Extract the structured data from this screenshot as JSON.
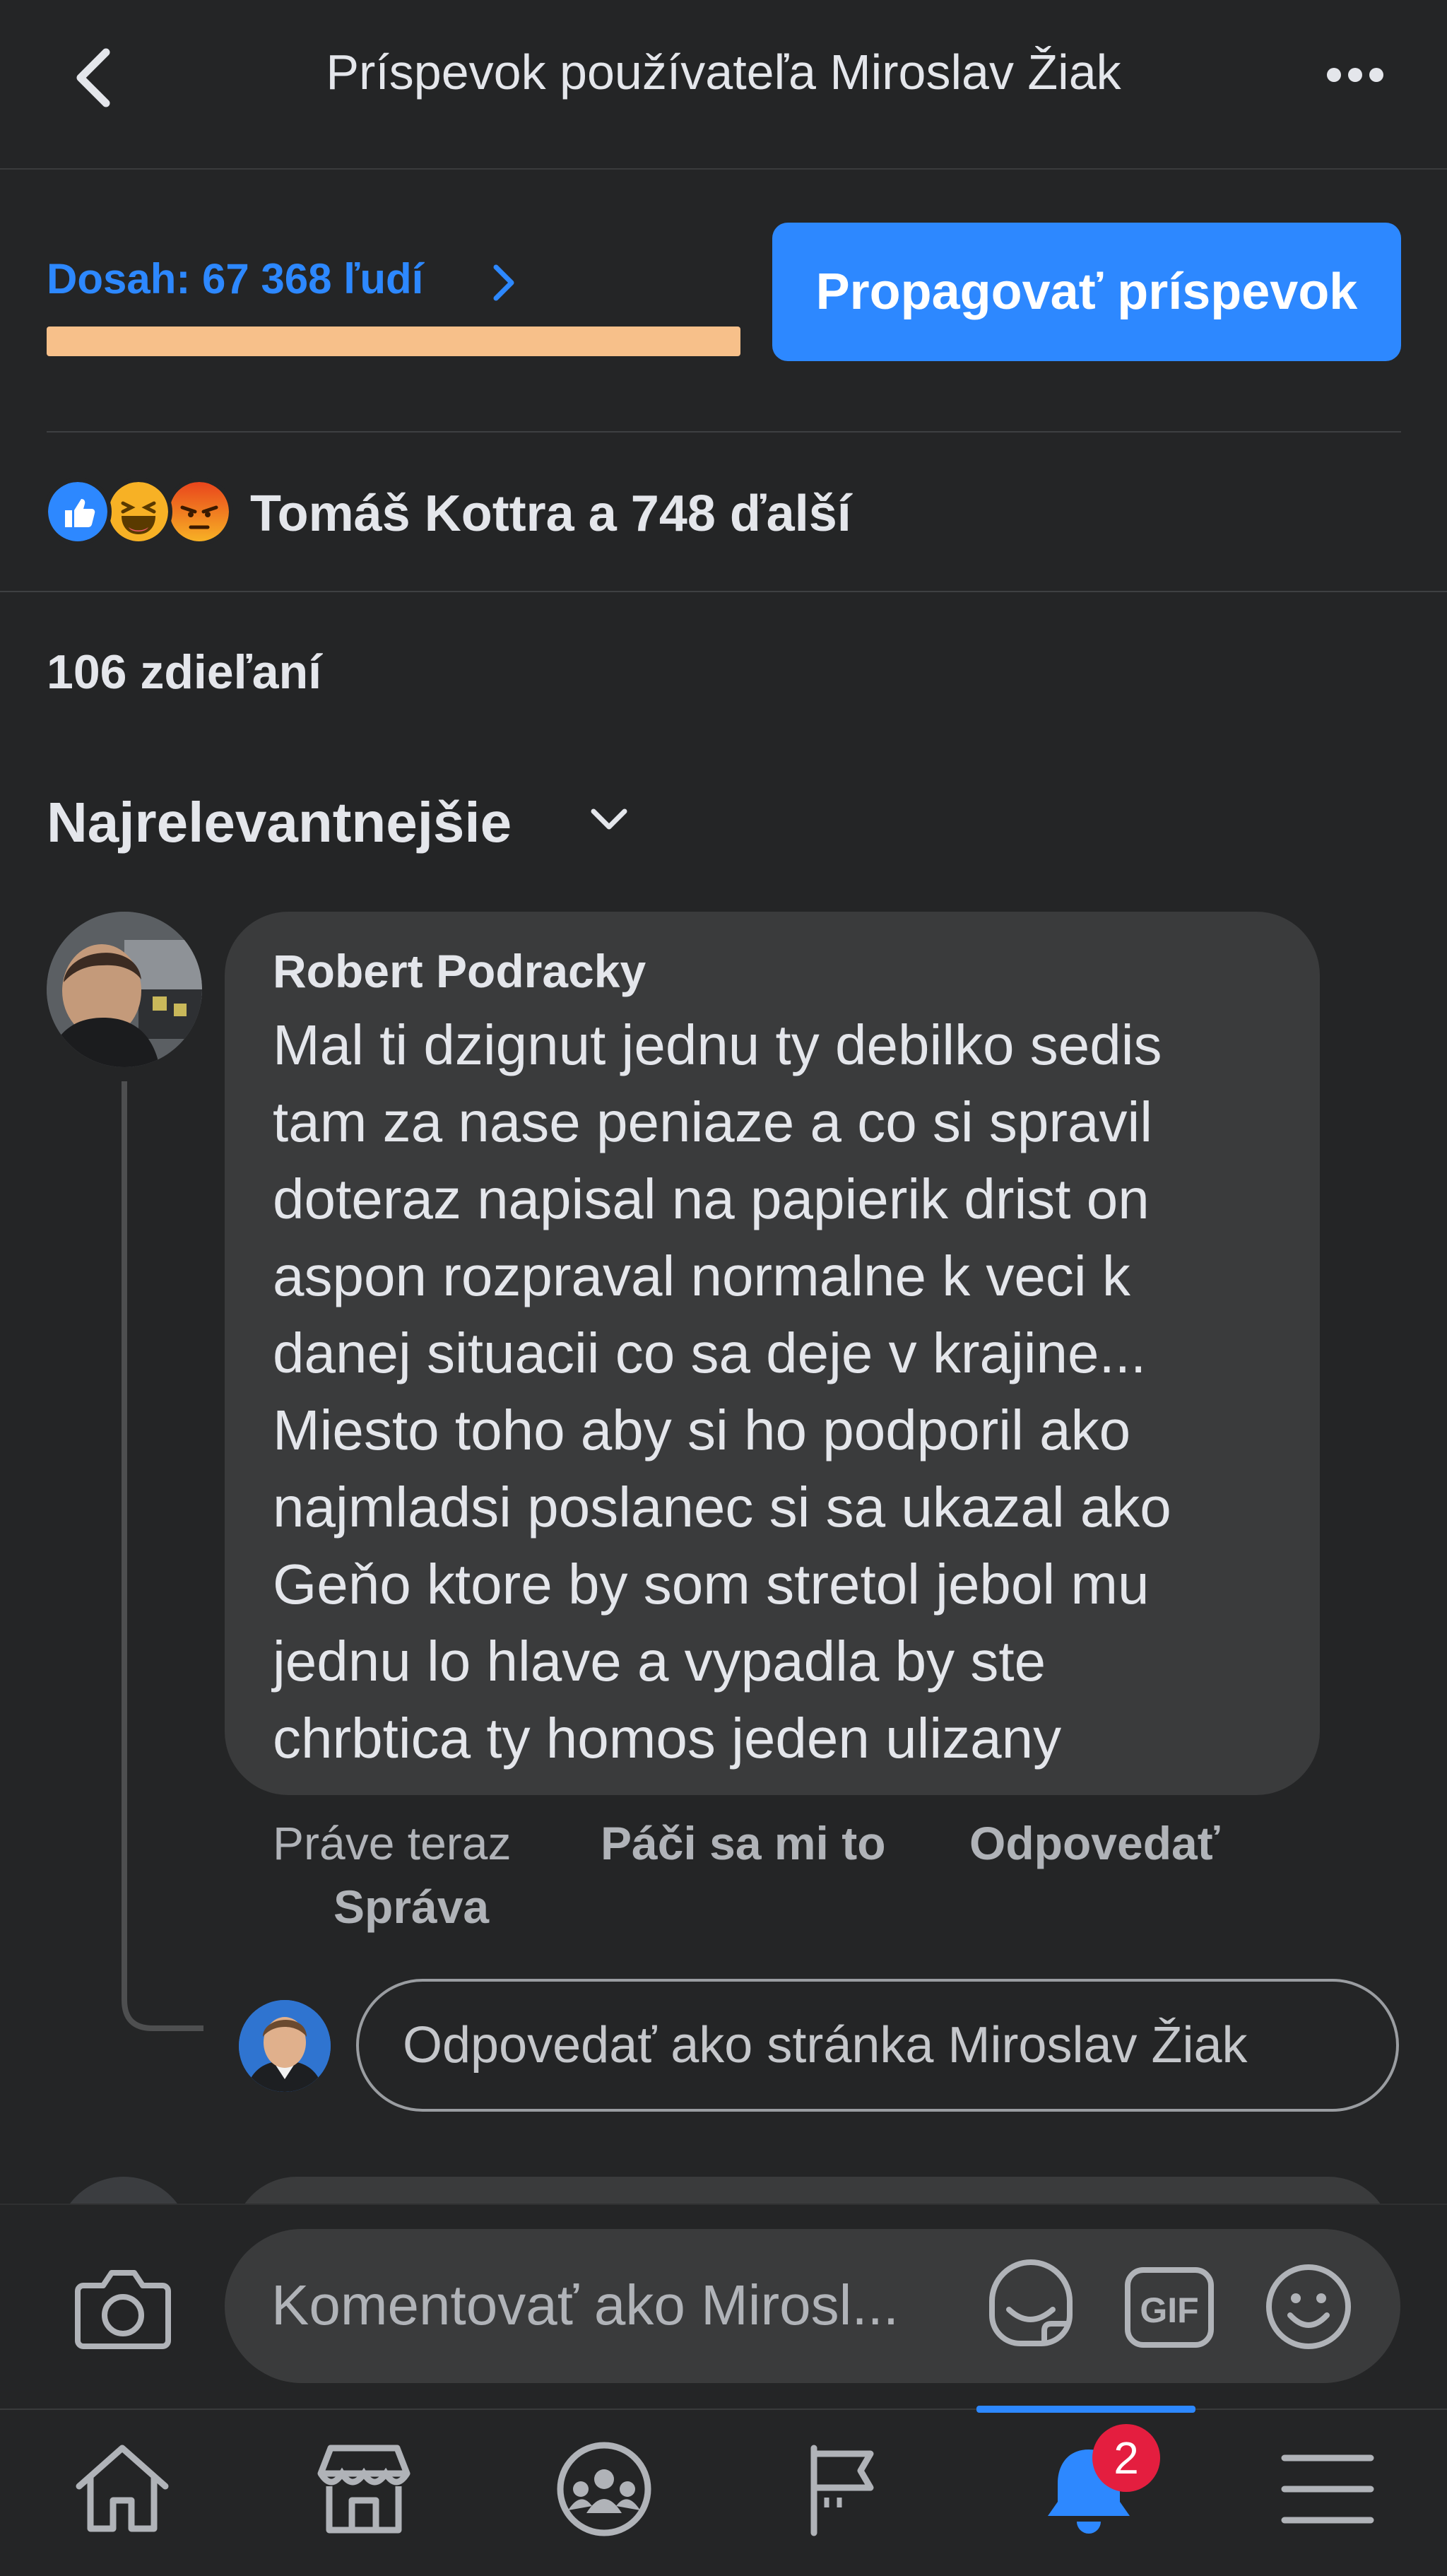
{
  "header": {
    "title": "Príspevok používateľa Miroslav Žiak"
  },
  "reach": {
    "label": "Dosah: 67 368 ľudí",
    "bar_fill": 1.0,
    "bar_color": "#f7c08a"
  },
  "promote_button": "Propagovať príspevok",
  "reactions": {
    "icons": [
      "like-icon",
      "haha-icon",
      "angry-icon"
    ],
    "summary": "Tomáš Kottra a 748 ďalší"
  },
  "shares": "106 zdieľaní",
  "sort": "Najrelevantnejšie",
  "comment": {
    "author": "Robert Podracky",
    "text": "Mal ti dzignut jednu ty debilko sedis\ntam za nase peniaze a co si  spravil\ndoteraz napisal na papierik drist on\naspon rozpraval normalne k veci k\ndanej situacii co sa deje v krajine...\nMiesto toho aby si ho podporil ako\nnajmladsi poslanec si sa ukazal ako\nGeňo ktore by som stretol jebol mu\njednu lo hlave a vypadla by ste\nchrbtica ty homos jeden ulizany",
    "time": "Práve teraz",
    "like": "Páči sa mi to",
    "reply": "Odpovedať",
    "message": "Správa"
  },
  "reply_input": {
    "placeholder": "Odpovedať ako stránka Miroslav Žiak"
  },
  "composer": {
    "placeholder": "Komentovať ako Mirosl...",
    "gif_label": "GIF"
  },
  "nav": {
    "items": [
      "home-icon",
      "marketplace-icon",
      "groups-icon",
      "pages-icon",
      "notifications-icon",
      "menu-icon"
    ],
    "active": "notifications-icon",
    "notifications_badge": "2"
  },
  "colors": {
    "background": "#242526",
    "accent": "#2d88ff",
    "bubble": "#3a3b3c",
    "badge": "#e41e3f"
  }
}
